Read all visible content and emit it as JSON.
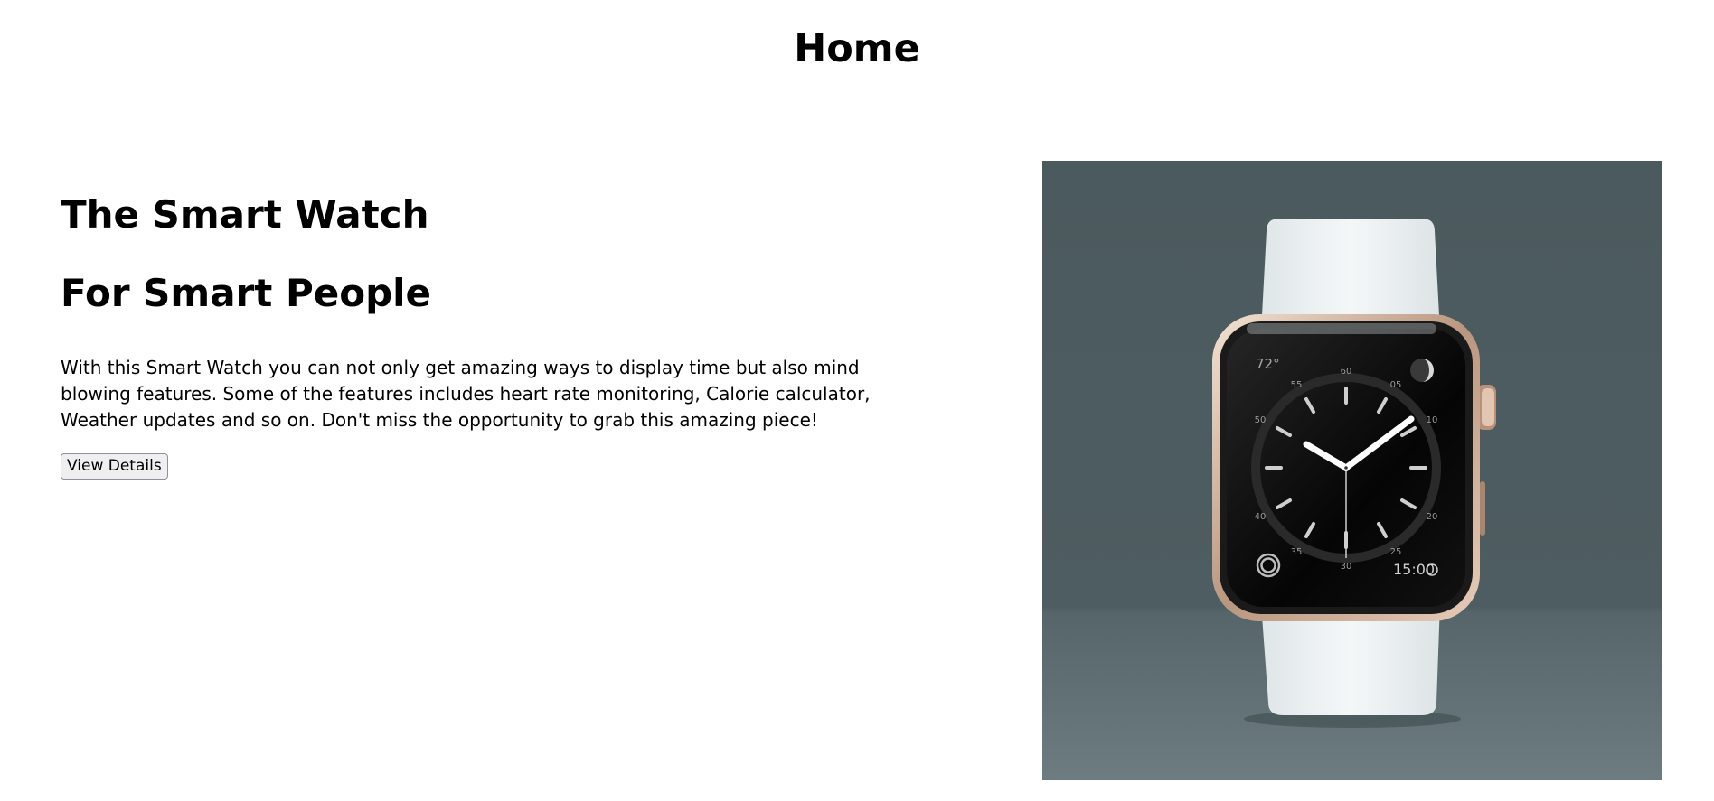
{
  "header": {
    "title": "Home"
  },
  "hero": {
    "headline_line1": "The Smart Watch",
    "headline_line2": "For Smart People",
    "description": "With this Smart Watch you can not only get amazing ways to display time but also mind blowing features. Some of the features includes heart rate monitoring, Calorie calculator, Weather updates and so on. Don't miss the opportunity to grab this amazing piece!",
    "button_label": "View Details"
  },
  "watch_face": {
    "temperature": "72°",
    "timer": "15:00",
    "minute_marks": [
      "60",
      "05",
      "10",
      "20",
      "25",
      "30",
      "35",
      "40",
      "50",
      "55"
    ]
  },
  "colors": {
    "image_background": "#4f5f63",
    "band": "#e9eef0",
    "case": "#c9a78f"
  }
}
